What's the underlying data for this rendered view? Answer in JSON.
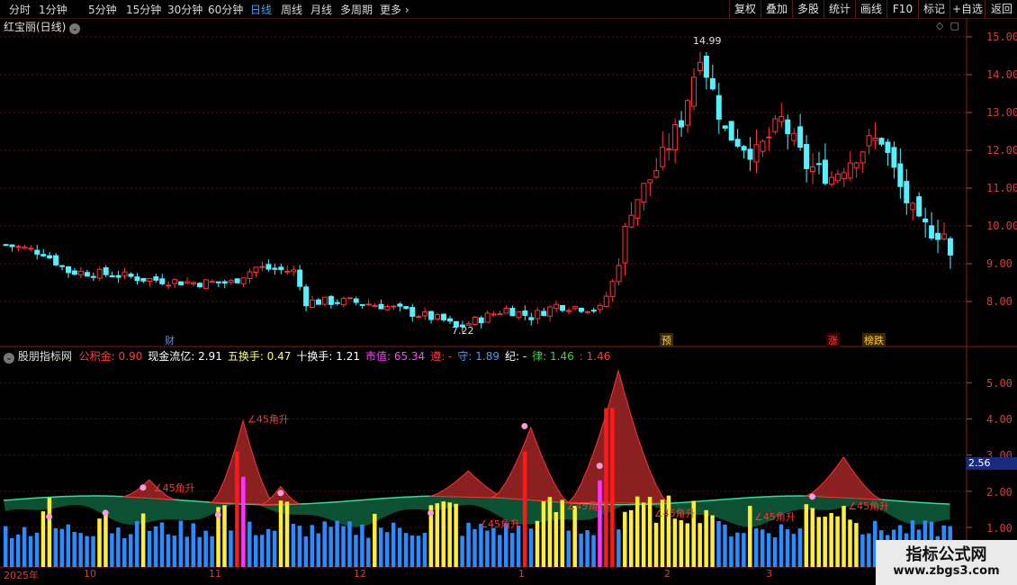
{
  "toolbar": {
    "periods": [
      "分时",
      "1分钟",
      "5分钟",
      "15分钟",
      "30分钟",
      "60分钟",
      "日线",
      "周线",
      "月线",
      "多周期",
      "更多"
    ],
    "active_period": "日线",
    "tools": [
      "复权",
      "叠加",
      "多股",
      "统计",
      "画线",
      "F10",
      "标记",
      "+自选",
      "返回"
    ]
  },
  "main_panel": {
    "title": "红宝丽(日线)",
    "y_ticks": [
      "15.00",
      "14.00",
      "13.00",
      "12.00",
      "11.00",
      "10.00",
      "9.00",
      "8.00"
    ],
    "high_label": "14.99",
    "low_label": "7.22",
    "markers": [
      {
        "text": "财",
        "color": "#3da0ff"
      },
      {
        "text": "预",
        "color": "#ffcc33"
      },
      {
        "text": "涨",
        "color": "#ff4040"
      },
      {
        "text": "榜跌",
        "color": "#ffcc33"
      }
    ]
  },
  "indicator_panel": {
    "name": "股朋指标网",
    "items": [
      {
        "label": "公积金:",
        "value": "0.90",
        "color": "#ff3a3a"
      },
      {
        "label": "现金流亿:",
        "value": "2.91",
        "color": "#ffffff"
      },
      {
        "label": "五换手:",
        "value": "0.47",
        "color": "#ffff66"
      },
      {
        "label": "十换手:",
        "value": "1.21",
        "color": "#ffffff"
      },
      {
        "label": "市值:",
        "value": "65.34",
        "color": "#ff44ff"
      },
      {
        "label": "遵:",
        "value": "-",
        "color": "#ff3a3a"
      },
      {
        "label": "守:",
        "value": "1.89",
        "color": "#3da0ff"
      },
      {
        "label": "纪:",
        "value": "-",
        "color": "#ffffff"
      },
      {
        "label": "律:",
        "value": "1.46",
        "color": "#33dd33"
      },
      {
        "label": ":",
        "value": "1.46",
        "color": "#ff3a3a"
      }
    ],
    "y_ticks": [
      "5.00",
      "4.00",
      "3.00",
      "2.00",
      "1.00"
    ],
    "current_value": "2.56",
    "angle_label": "45角升"
  },
  "x_axis": {
    "labels": [
      "2025年",
      "10",
      "11",
      "12",
      "1",
      "2",
      "3"
    ]
  },
  "watermark": {
    "title": "指标公式网",
    "url": "www.zbgs3.com"
  },
  "colors": {
    "up": "#ff3333",
    "down": "#54f0ff",
    "grid": "#5a0f0f",
    "axis": "#d04040"
  }
}
